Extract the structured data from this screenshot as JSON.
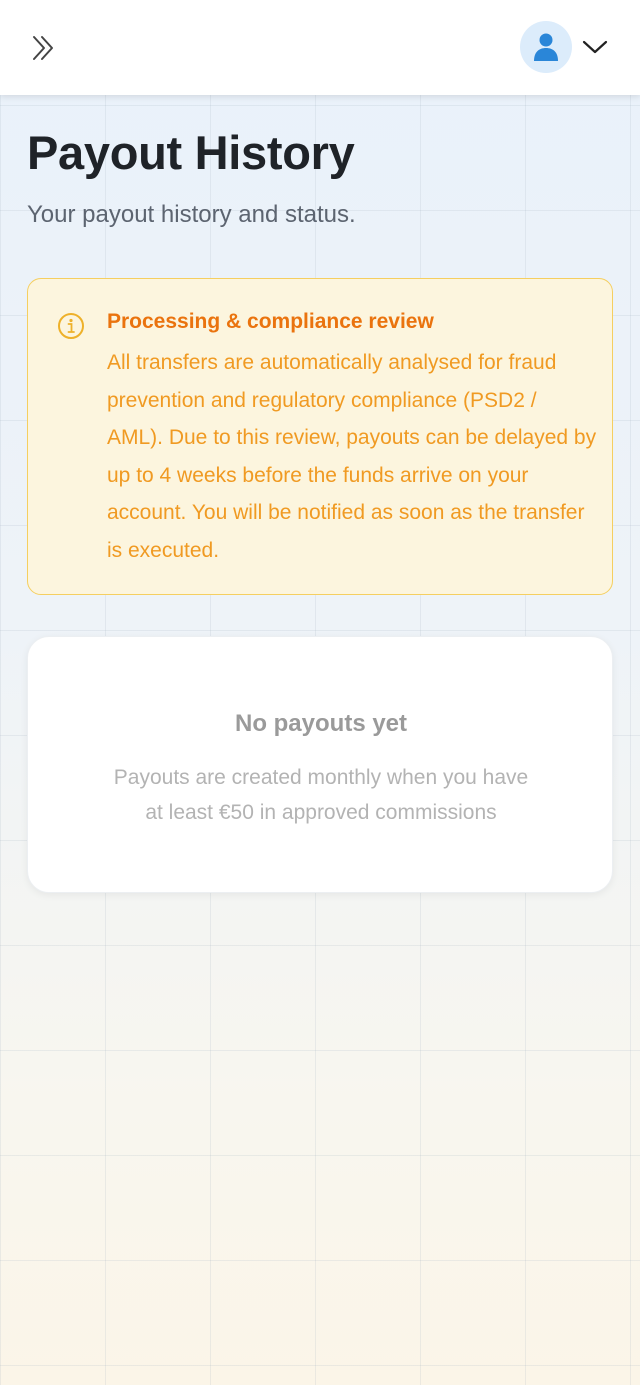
{
  "header": {
    "expand_icon": "double-chevron-right-icon",
    "avatar_icon": "user-icon",
    "menu_icon": "chevron-down-icon"
  },
  "page": {
    "title": "Payout History",
    "subtitle": "Your payout history and status."
  },
  "notice": {
    "icon": "info-icon",
    "title": "Processing & compliance review",
    "body": "All transfers are automatically analysed for fraud prevention and regulatory compliance (PSD2 / AML). Due to this review, payouts can be delayed by up to 4 weeks before the funds arrive on your account. You will be notified as soon as the transfer is executed."
  },
  "empty_state": {
    "title": "No payouts yet",
    "line1": "Payouts are created monthly when you have",
    "line2": "at least €50 in approved commissions"
  },
  "colors": {
    "accent_blue": "#2a86d8",
    "notice_title": "#ea730e",
    "notice_text": "#f09a22",
    "notice_border": "#f5cf60",
    "notice_bg": "#fcf5de"
  }
}
